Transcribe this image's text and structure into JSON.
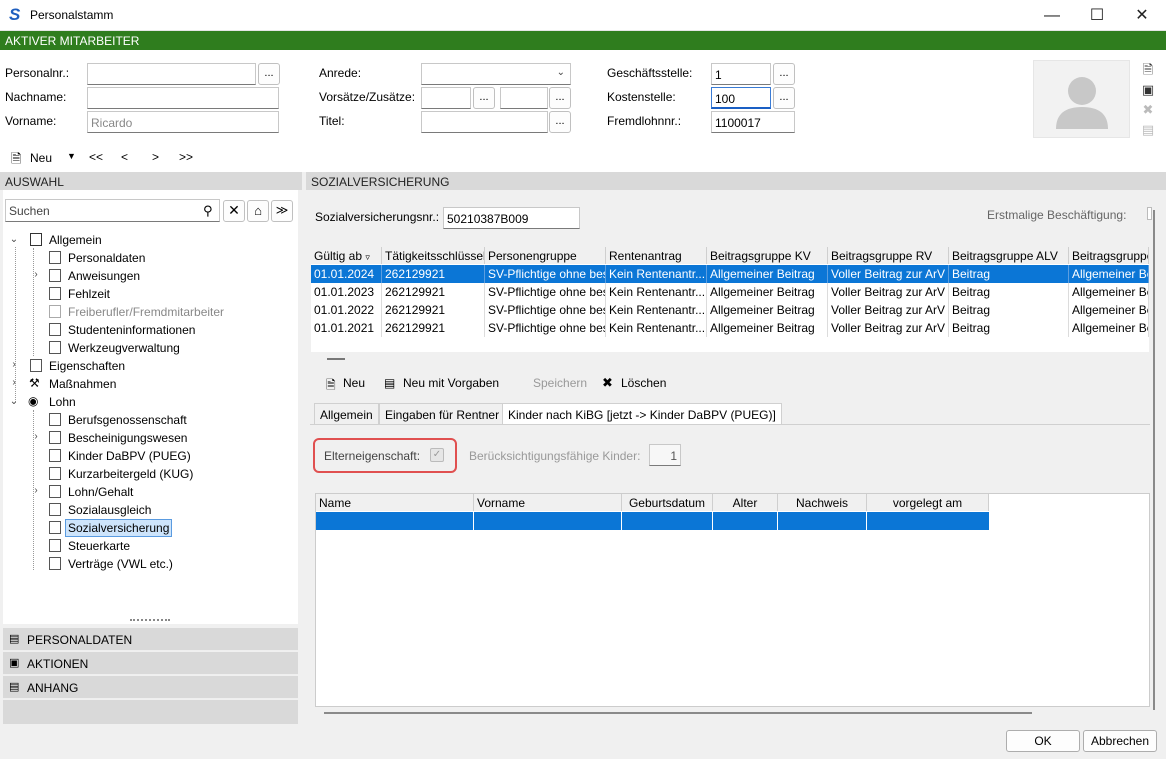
{
  "window": {
    "title": "Personalstamm"
  },
  "banner": "AKTIVER MITARBEITER",
  "header": {
    "personalnr_label": "Personalnr.:",
    "personalnr_value": "",
    "nachname_label": "Nachname:",
    "nachname_value": "",
    "vorname_label": "Vorname:",
    "vorname_value": "Ricardo",
    "anrede_label": "Anrede:",
    "anrede_value": "",
    "vorsaetze_label": "Vorsätze/Zusätze:",
    "titel_label": "Titel:",
    "geschaeftsstelle_label": "Geschäftsstelle:",
    "geschaeftsstelle_value": "1",
    "kostenstelle_label": "Kostenstelle:",
    "kostenstelle_value": "100",
    "fremdlohnnr_label": "Fremdlohnnr.:",
    "fremdlohnnr_value": "1100017",
    "dots": "..."
  },
  "toolbar": {
    "new_label": "Neu",
    "first": "<<",
    "prev": "<",
    "next": ">",
    "last": ">>"
  },
  "auswahl": {
    "header": "AUSWAHL",
    "search_placeholder": "Suchen"
  },
  "tree": [
    {
      "label": "Allgemein"
    },
    {
      "label": "Personaldaten"
    },
    {
      "label": "Anweisungen"
    },
    {
      "label": "Fehlzeit"
    },
    {
      "label": "Freiberufler/Fremdmitarbeiter"
    },
    {
      "label": "Studenteninformationen"
    },
    {
      "label": "Werkzeugverwaltung"
    },
    {
      "label": "Eigenschaften"
    },
    {
      "label": "Maßnahmen"
    },
    {
      "label": "Lohn"
    },
    {
      "label": "Berufsgenossenschaft"
    },
    {
      "label": "Bescheinigungswesen"
    },
    {
      "label": "Kinder DaBPV (PUEG)"
    },
    {
      "label": "Kurzarbeitergeld (KUG)"
    },
    {
      "label": "Lohn/Gehalt"
    },
    {
      "label": "Sozialausgleich"
    },
    {
      "label": "Sozialversicherung"
    },
    {
      "label": "Steuerkarte"
    },
    {
      "label": "Verträge (VWL etc.)"
    }
  ],
  "accordion": [
    "PERSONALDATEN",
    "AKTIONEN",
    "ANHANG"
  ],
  "sv": {
    "header": "SOZIALVERSICHERUNG",
    "svnr_label": "Sozialversicherungsnr.:",
    "svnr_value": "50210387B009",
    "erstmalig_label": "Erstmalige Beschäftigung:",
    "columns": [
      "Gültig ab",
      "Tätigkeitsschlüssel",
      "Personengruppe",
      "Rentenantrag",
      "Beitragsgruppe KV",
      "Beitragsgruppe RV",
      "Beitragsgruppe ALV",
      "Beitragsgruppe"
    ],
    "rows": [
      [
        "01.01.2024",
        "262129921",
        "SV-Pflichtige ohne bes",
        "Kein Rentenantr...",
        "Allgemeiner Beitrag",
        "Voller Beitrag zur ArV",
        "Beitrag",
        "Allgemeiner Be"
      ],
      [
        "01.01.2023",
        "262129921",
        "SV-Pflichtige ohne bes",
        "Kein Rentenantr...",
        "Allgemeiner Beitrag",
        "Voller Beitrag zur ArV",
        "Beitrag",
        "Allgemeiner Be"
      ],
      [
        "01.01.2022",
        "262129921",
        "SV-Pflichtige ohne bes",
        "Kein Rentenantr...",
        "Allgemeiner Beitrag",
        "Voller Beitrag zur ArV",
        "Beitrag",
        "Allgemeiner Be"
      ],
      [
        "01.01.2021",
        "262129921",
        "SV-Pflichtige ohne bes",
        "Kein Rentenantr...",
        "Allgemeiner Beitrag",
        "Voller Beitrag zur ArV",
        "Beitrag",
        "Allgemeiner Be"
      ]
    ],
    "actions": {
      "new": "Neu",
      "new_template": "Neu mit Vorgaben",
      "save": "Speichern",
      "delete": "Löschen"
    },
    "tabs": [
      "Allgemein",
      "Eingaben für Rentner",
      "Kinder nach KiBG [jetzt -> Kinder DaBPV (PUEG)]"
    ],
    "elterneigenschaft_label": "Elterneigenschaft:",
    "kinder_label": "Berücksichtigungsfähige Kinder:",
    "kinder_value": "1",
    "kid_columns": [
      "Name",
      "Vorname",
      "Geburtsdatum",
      "Alter",
      "Nachweis",
      "vorgelegt am"
    ]
  },
  "footer": {
    "ok": "OK",
    "cancel": "Abbrechen"
  }
}
